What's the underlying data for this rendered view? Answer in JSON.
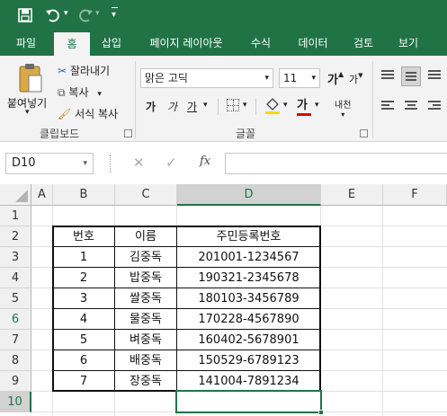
{
  "quick_access": {
    "save_icon": "save-icon",
    "undo_icon": "undo-icon",
    "redo_icon": "redo-icon",
    "customize_icon": "chevron-down-icon"
  },
  "tabs": [
    "파일",
    "홈",
    "삽입",
    "페이지 레이아웃",
    "수식",
    "데이터",
    "검토",
    "보기"
  ],
  "active_tab": "홈",
  "ribbon": {
    "clipboard": {
      "paste_label": "붙여넣기",
      "cut_label": "잘라내기",
      "copy_label": "복사",
      "format_painter_label": "서식 복사",
      "group_label": "클립보드"
    },
    "font": {
      "font_name": "맑은 고딕",
      "font_size": "11",
      "grow_label": "가",
      "shrink_label": "가",
      "bold_label": "가",
      "italic_label": "가",
      "underline_label": "가",
      "font_color_label": "가",
      "phonetic_label": "내천",
      "group_label": "글꼴",
      "font_color": "#e00000"
    }
  },
  "formula_bar": {
    "name_box": "D10",
    "cancel_icon": "x-icon",
    "enter_icon": "check-icon",
    "fx_label": "fx",
    "formula": ""
  },
  "grid": {
    "columns": [
      "A",
      "B",
      "C",
      "D",
      "E",
      "F"
    ],
    "rows": [
      "1",
      "2",
      "3",
      "4",
      "5",
      "6",
      "7",
      "8",
      "9",
      "10"
    ],
    "selected_column": "D",
    "selected_row": "10",
    "table": {
      "headers": [
        "번호",
        "이름",
        "주민등록번호"
      ],
      "rows": [
        [
          "1",
          "김중독",
          "201001-1234567"
        ],
        [
          "2",
          "밥중독",
          "190321-2345678"
        ],
        [
          "3",
          "쌀중독",
          "180103-3456789"
        ],
        [
          "4",
          "물중독",
          "170228-4567890"
        ],
        [
          "5",
          "벼중독",
          "160402-5678901"
        ],
        [
          "6",
          "배중독",
          "150529-6789123"
        ],
        [
          "7",
          "장중독",
          "141004-7891234"
        ]
      ]
    }
  },
  "colors": {
    "accent": "#217346",
    "selection": "#217346"
  }
}
